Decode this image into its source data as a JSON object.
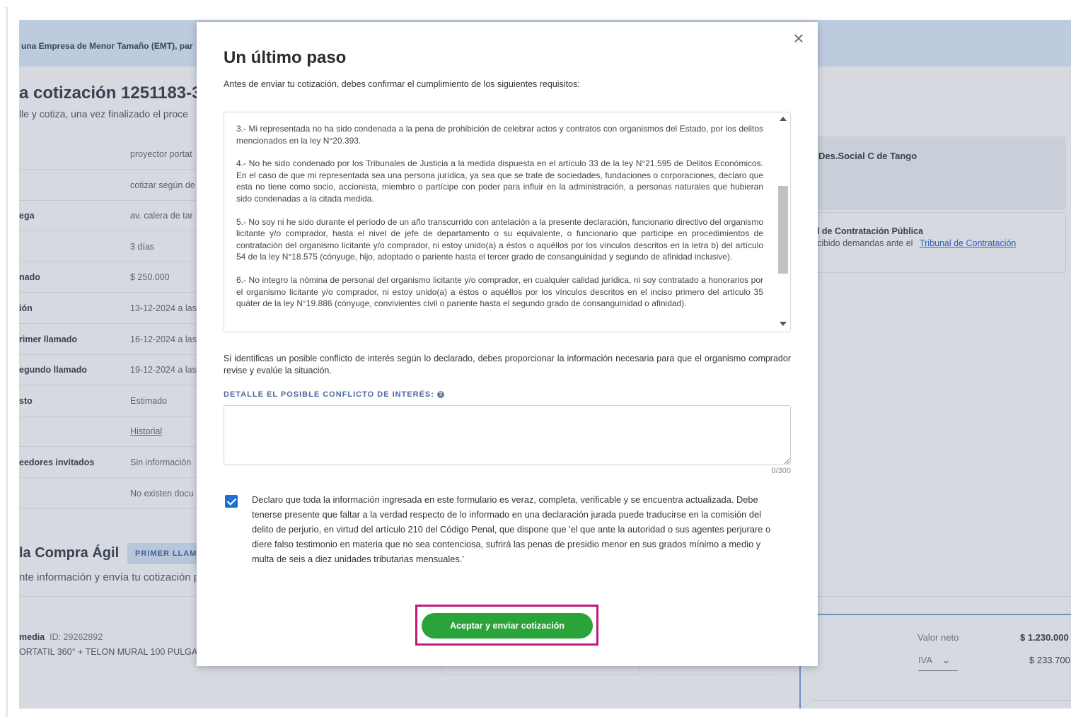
{
  "background": {
    "banner_text": "una Empresa de Menor Tamaño (EMT), par",
    "title": "a cotización 1251183-3",
    "subtitle": "lle y cotiza, una vez finalizado el proce",
    "rows": [
      {
        "label": "",
        "value": "proyector portat"
      },
      {
        "label": "",
        "value": "cotizar según de"
      },
      {
        "label": "ega",
        "value": "av. calera de tar"
      },
      {
        "label": "",
        "value": "3 días"
      },
      {
        "label": "nado",
        "value": "$ 250.000"
      },
      {
        "label": "ión",
        "value": "13-12-2024 a las"
      },
      {
        "label": "rimer llamado",
        "value": "16-12-2024 a las"
      },
      {
        "label": "egundo llamado",
        "value": "19-12-2024 a las"
      },
      {
        "label": "sto",
        "value": "Estimado"
      },
      {
        "label": "",
        "value": "Historial"
      },
      {
        "label": "eedores invitados",
        "value": "Sin información"
      },
      {
        "label": "",
        "value": "No existen docu"
      }
    ],
    "section_title": "la Compra Ágil",
    "section_badge": "PRIMER LLAMA",
    "section_text": "nte información y envía tu cotización p",
    "item_name": "media",
    "item_id": "ID: 29262892",
    "item_desc": "ORTATIL 360° + TELON MURAL 100 PULGA",
    "right_card_title": "Des.Social C de Tango",
    "right_card2_title": "al de Contratación Pública",
    "right_card2_text": "ecibido demandas ante el",
    "right_card2_link": "Tribunal de Contratación",
    "valor_neto_label": "Valor neto",
    "valor_neto": "$ 1.230.000",
    "iva_label": "IVA",
    "iva_value": "$ 233.700"
  },
  "modal": {
    "title": "Un último paso",
    "intro": "Antes de enviar tu cotización, debes confirmar el cumplimiento de los siguientes requisitos:",
    "requirements": [
      "3.- Mi representada no ha sido condenada a la pena de prohibición de celebrar actos y contratos con organismos del Estado, por los delitos mencionados en la ley N°20.393.",
      "4.- No he sido condenado por los Tribunales de Justicia a la medida dispuesta en el artículo 33 de la ley N°21.595 de Delitos Económicos. En el caso de que mi representada sea una persona jurídica, ya sea que se trate de sociedades, fundaciones o corporaciones, declaro que esta no tiene como socio, accionista, miembro o partícipe con poder para influir en la administración, a personas naturales que hubieran sido condenadas a la citada medida.",
      "5.- No soy ni he sido durante el período de un año transcurrido con antelación a la presente declaración, funcionario directivo del organismo licitante y/o comprador, hasta el nivel de jefe de departamento o su equivalente, o funcionario que participe en procedimientos de contratación del organismo licitante y/o comprador, ni estoy unido(a) a éstos o aquéllos por los vínculos descritos en la letra b) del artículo 54 de la ley N°18.575 (cónyuge, hijo, adoptado o pariente hasta el tercer grado de consanguinidad y segundo de afinidad inclusive).",
      "6.- No integro la nómina de personal del organismo licitante y/o comprador, en cualquier calidad jurídica, ni soy contratado a honorarios por el organismo licitante y/o comprador, ni estoy unido(a) a éstos o aquéllos por los vínculos descritos en el inciso primero del artículo 35 quáter de la ley N°19.886 (cónyuge, convivientes civil o pariente hasta el segundo grado de consanguinidad o afinidad)."
    ],
    "conflict_note": "Si identificas un posible conflicto de interés según lo declarado, debes proporcionar la información necesaria para que el organismo comprador revise y evalúe la situación.",
    "conflict_label": "DETALLE EL POSIBLE CONFLICTO DE INTERÉS:",
    "conflict_value": "",
    "char_count": "0/300",
    "declaration_checked": true,
    "declaration": "Declaro que toda la información ingresada en este formulario es veraz, completa, verificable y se encuentra actualizada. Debe tenerse presente que faltar a la verdad respecto de lo informado en una declaración jurada puede traducirse en la comisión del delito de perjurio, en virtud del artículo 210 del Código Penal, que dispone que 'el que ante la autoridad o sus agentes perjurare o diere falso testimonio en materia que no sea contenciosa, sufrirá las penas de presidio menor en sus grados mínimo a medio y multa de seis a diez unidades tributarias mensuales.'",
    "submit_label": "Aceptar y enviar cotización",
    "close_symbol": "×"
  },
  "colors": {
    "submit_green": "#2aa33a",
    "highlight_magenta": "#c21a7a",
    "checkbox_blue": "#1f6fd1",
    "overlay_gray": "#d6dae0"
  },
  "icons": {
    "close": "close-icon",
    "info": "info-icon",
    "check": "checkbox-check-icon",
    "chevron": "chevron-down-icon"
  }
}
